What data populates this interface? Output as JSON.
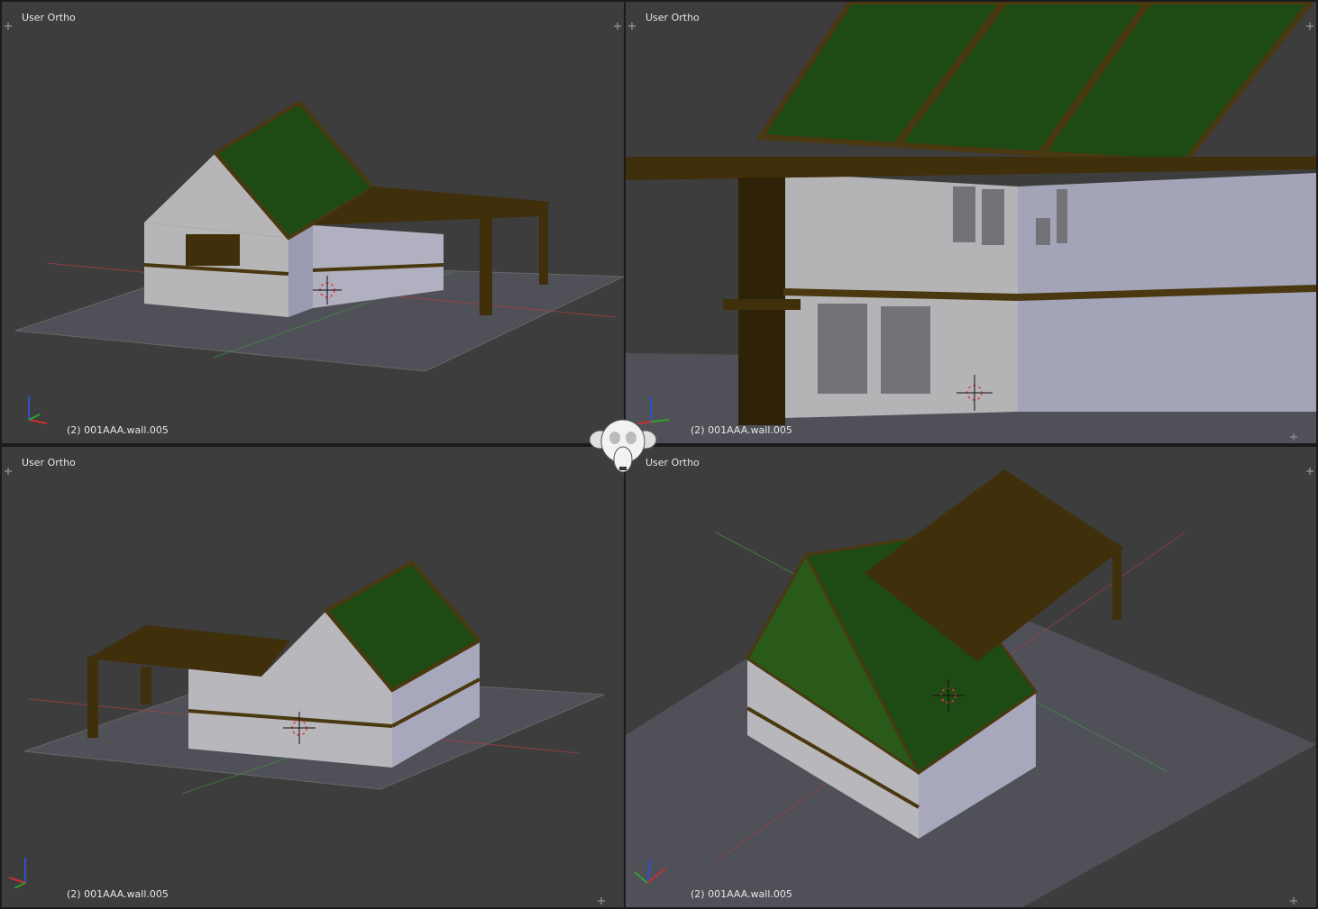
{
  "viewports": [
    {
      "title": "User Ortho",
      "object_label": "(2) 001AAA.wall.005"
    },
    {
      "title": "User Ortho",
      "object_label": "(2) 001AAA.wall.005"
    },
    {
      "title": "User Ortho",
      "object_label": "(2) 001AAA.wall.005"
    },
    {
      "title": "User Ortho",
      "object_label": "(2) 001AAA.wall.005"
    }
  ],
  "colors": {
    "background": "#3d3d3d",
    "grid_floor": "#505058",
    "wall": "#b0b0b4",
    "wall_side": "#9a9aae",
    "roof": "#1e4a14",
    "beam": "#3f2f0a",
    "axis_x": "#c83030",
    "axis_y": "#30a030",
    "axis_z": "#3050d0"
  },
  "icons": {
    "split_handle": "plus-icon",
    "cursor": "3d-cursor-icon",
    "logo": "blender-monkey-logo"
  }
}
